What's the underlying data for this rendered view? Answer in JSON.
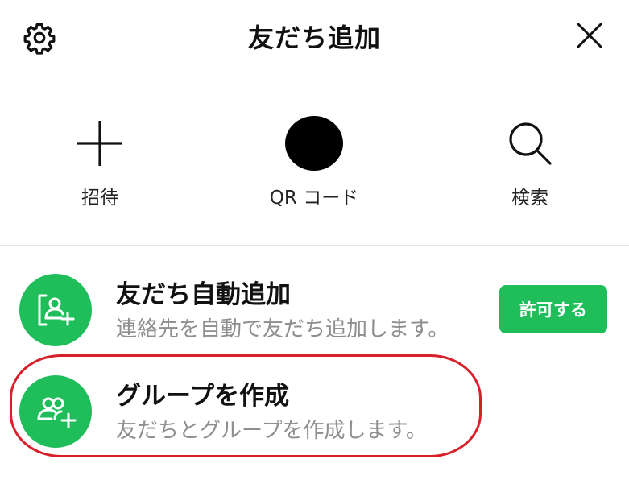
{
  "header": {
    "title": "友だち追加",
    "settings_icon": "gear-icon",
    "close_icon": "close-icon"
  },
  "actions": [
    {
      "label": "招待",
      "icon": "plus-icon"
    },
    {
      "label": "QR コード",
      "icon": "qr-code-icon"
    },
    {
      "label": "検索",
      "icon": "search-icon"
    }
  ],
  "list": [
    {
      "title": "友だち自動追加",
      "subtitle": "連絡先を自動で友だち追加します。",
      "icon": "contact-sync-icon",
      "button_label": "許可する"
    },
    {
      "title": "グループを作成",
      "subtitle": "友だちとグループを作成します。",
      "icon": "group-add-icon"
    }
  ],
  "colors": {
    "accent": "#1fbe5b",
    "annotation": "#d81f2a",
    "subtext": "#8e8e8e"
  }
}
